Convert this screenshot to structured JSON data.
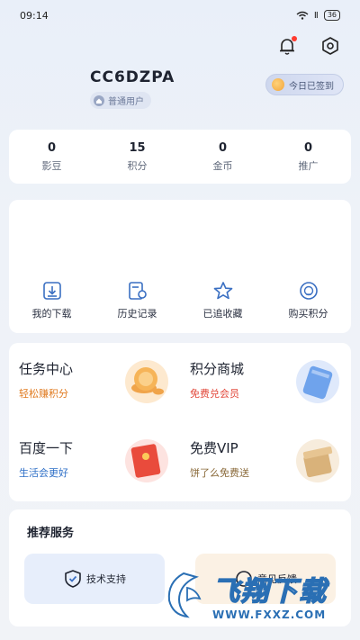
{
  "status_bar": {
    "time": "09:14",
    "signal": "Ⅱ",
    "battery": "36"
  },
  "profile": {
    "username": "CC6DZPA",
    "login_label": "普通用户"
  },
  "checkin": {
    "label": "今日已签到"
  },
  "stats": [
    {
      "value": "0",
      "label": "影豆"
    },
    {
      "value": "15",
      "label": "积分"
    },
    {
      "value": "0",
      "label": "金币"
    },
    {
      "value": "0",
      "label": "推广"
    }
  ],
  "shortcuts": [
    {
      "label": "我的下载",
      "icon": "download-icon"
    },
    {
      "label": "历史记录",
      "icon": "history-icon"
    },
    {
      "label": "已追收藏",
      "icon": "star-icon"
    },
    {
      "label": "购买积分",
      "icon": "points-icon"
    }
  ],
  "grid": [
    {
      "title": "任务中心",
      "subtitle": "轻松赚积分",
      "color": "#e07a1f",
      "icon": "coin-stack-icon"
    },
    {
      "title": "积分商城",
      "subtitle": "免费兑会员",
      "color": "#e2483b",
      "icon": "vip-card-icon"
    },
    {
      "title": "百度一下",
      "subtitle": "生活会更好",
      "color": "#2e6fc7",
      "icon": "red-envelope-icon"
    },
    {
      "title": "免费VIP",
      "subtitle": "饼了么免费送",
      "color": "#8a6a3a",
      "icon": "gift-box-icon"
    }
  ],
  "services": {
    "title": "推荐服务",
    "items": [
      {
        "label": "技术支持",
        "icon": "shield-check-icon"
      },
      {
        "label": "意见反馈",
        "icon": "feedback-icon"
      }
    ]
  },
  "watermark": {
    "brand": "飞翔下载",
    "url": "WWW.FXXZ.COM"
  },
  "colors": {
    "accent_blue": "#2e6fc7",
    "orange": "#e07a1f",
    "red": "#e2483b",
    "card": "#ffffff"
  }
}
